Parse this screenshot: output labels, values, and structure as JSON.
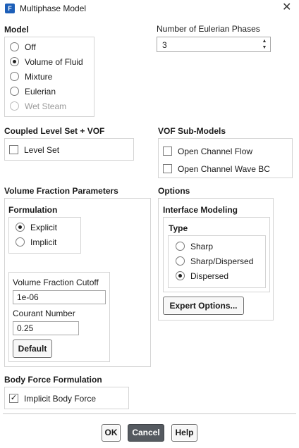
{
  "window": {
    "title": "Multiphase Model",
    "app_icon_letter": "F"
  },
  "model": {
    "title": "Model",
    "options": [
      {
        "label": "Off",
        "selected": false,
        "disabled": false
      },
      {
        "label": "Volume of Fluid",
        "selected": true,
        "disabled": false
      },
      {
        "label": "Mixture",
        "selected": false,
        "disabled": false
      },
      {
        "label": "Eulerian",
        "selected": false,
        "disabled": false
      },
      {
        "label": "Wet Steam",
        "selected": false,
        "disabled": true
      }
    ]
  },
  "eulerian_phases": {
    "label": "Number of Eulerian Phases",
    "value": "3"
  },
  "coupled_level_set": {
    "title": "Coupled Level Set + VOF",
    "level_set_label": "Level Set",
    "level_set_checked": false
  },
  "vof_submodels": {
    "title": "VOF Sub-Models",
    "items": [
      {
        "label": "Open Channel Flow",
        "checked": false
      },
      {
        "label": "Open Channel Wave BC",
        "checked": false
      }
    ]
  },
  "volume_fraction": {
    "title": "Volume Fraction Parameters",
    "formulation_title": "Formulation",
    "formulation_options": [
      {
        "label": "Explicit",
        "selected": true
      },
      {
        "label": "Implicit",
        "selected": false
      }
    ],
    "cutoff_label": "Volume Fraction Cutoff",
    "cutoff_value": "1e-06",
    "courant_label": "Courant Number",
    "courant_value": "0.25",
    "default_button": "Default"
  },
  "options": {
    "title": "Options",
    "interface_title": "Interface Modeling",
    "type_title": "Type",
    "type_options": [
      {
        "label": "Sharp",
        "selected": false
      },
      {
        "label": "Sharp/Dispersed",
        "selected": false
      },
      {
        "label": "Dispersed",
        "selected": true
      }
    ],
    "expert_button": "Expert Options..."
  },
  "body_force": {
    "title": "Body Force Formulation",
    "label": "Implicit Body Force",
    "checked": true,
    "check_glyph": "✓"
  },
  "buttons": {
    "ok": "OK",
    "cancel": "Cancel",
    "help": "Help"
  },
  "icons": {
    "close": "close-icon",
    "spinner": "spinner-arrows-icon"
  }
}
